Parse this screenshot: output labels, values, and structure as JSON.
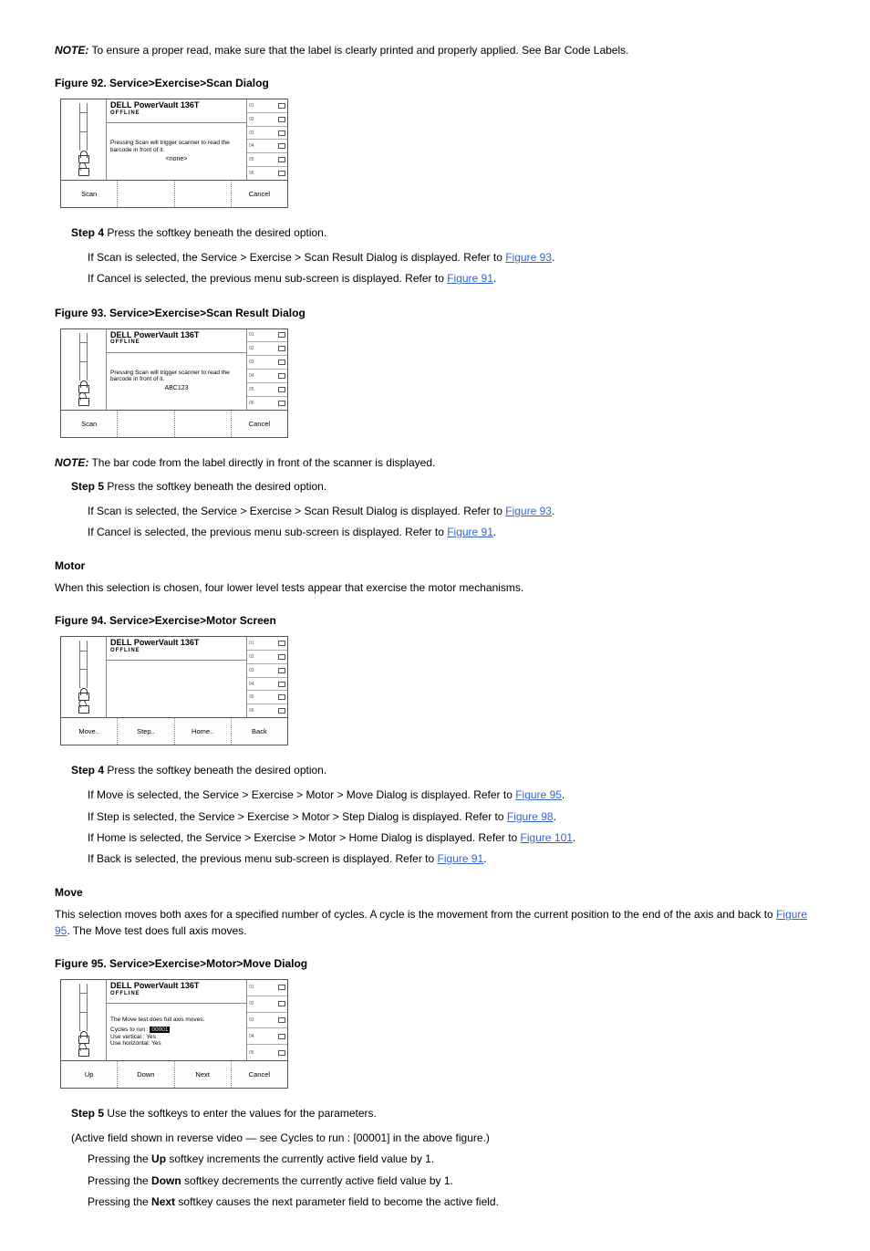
{
  "note1": {
    "label": "NOTE:",
    "text": " To ensure a proper read, make sure that the label is clearly printed and properly applied. See Bar Code Labels."
  },
  "fig92": {
    "label": "Figure 92. Service>Exercise>Scan Dialog",
    "logo": "DELL PowerVault 136T",
    "offline": "OFFLINE",
    "message": "Pressing Scan will trigger scanner to read the barcode in front of it.",
    "value": "<none>",
    "buttons": [
      "Scan",
      "",
      "",
      "Cancel"
    ]
  },
  "step4": {
    "num": "Step 4",
    "text": "   Press the softkey beneath the desired option."
  },
  "step4_items": [
    "If Scan is selected, the Service > Exercise > Scan Result Dialog is displayed. Refer to ",
    "If Cancel is selected, the previous menu sub-screen is displayed. Refer to "
  ],
  "step4_links": {
    "fig93": "Figure 93",
    "fig91": "Figure 91"
  },
  "fig93": {
    "label": "Figure 93. Service>Exercise>Scan Result Dialog",
    "logo": "DELL PowerVault 136T",
    "offline": "OFFLINE",
    "message": "Pressing Scan will trigger scanner to read the barcode in front of it.",
    "value": "ABC123",
    "buttons": [
      "Scan",
      "",
      "",
      "Cancel"
    ]
  },
  "note2": {
    "label": "NOTE:",
    "text": " The bar code from the label directly in front of the scanner is displayed."
  },
  "step5": {
    "num": "Step 5",
    "text": "   Press the softkey beneath the desired option."
  },
  "step5_items": [
    "If Scan is selected, the Service > Exercise > Scan Result Dialog is displayed. Refer to ",
    "If Cancel is selected, the previous menu sub-screen is displayed. Refer to "
  ],
  "step5_links": {
    "fig93": "Figure 93",
    "fig91": "Figure 91"
  },
  "motor_title": "Motor",
  "motor_text": "When this selection is chosen, four lower level tests appear that exercise the motor mechanisms.",
  "fig94": {
    "label": "Figure 94. Service>Exercise>Motor Screen",
    "logo": "DELL PowerVault 136T",
    "offline": "OFFLINE",
    "buttons": [
      "Move..",
      "Step..",
      "Home..",
      "Back"
    ]
  },
  "step4b": {
    "num": "Step 4",
    "text": "   Press the softkey beneath the desired option."
  },
  "step4b_items": [
    {
      "pre": "If Move is selected, the Service > Exercise > Motor > Move Dialog is displayed. Refer to ",
      "link": "Figure 95"
    },
    {
      "pre": "If Step is selected, the Service > Exercise > Motor > Step Dialog is displayed. Refer to ",
      "link": "Figure 98"
    },
    {
      "pre": "If Home is selected, the Service > Exercise > Motor > Home Dialog is displayed. Refer to ",
      "link": "Figure 101"
    },
    {
      "pre": "If Back is selected, the previous menu sub-screen is displayed. Refer to ",
      "link": "Figure 91"
    }
  ],
  "move_title": "Move",
  "move_text_pre": "This selection moves both axes for a specified number of cycles. A cycle is the movement from the current position to the end of the axis and back to ",
  "move_text_link": "Figure 95",
  "move_text_post": ". The Move test does full axis moves.",
  "fig95": {
    "label": "Figure 95. Service>Exercise>Motor>Move Dialog",
    "logo": "DELL PowerVault 136T",
    "offline": "OFFLINE",
    "message_top": "The Move test does full axis moves.",
    "line1": "Cycles to run :",
    "val1": "00001",
    "line2": "Use vertical  :",
    "val2": "Yes",
    "line3": "Use horizontal:",
    "val3": "Yes",
    "buttons": [
      "Up",
      "Down",
      "Next",
      "Cancel"
    ]
  },
  "step5b": {
    "num": "Step 5",
    "text": "   Use the softkeys to enter the values for the parameters."
  },
  "step5b_paren": "(Active field shown in reverse video — see Cycles to run : [00001] in the above figure.)",
  "step5b_items": [
    {
      "pre": "Pressing the ",
      "bold": "Up",
      "post": " softkey increments the currently active field value by 1."
    },
    {
      "pre": "Pressing the ",
      "bold": "Down",
      "post": " softkey decrements the currently active field value by 1."
    },
    {
      "pre": "Pressing the ",
      "bold": "Next",
      "post": " softkey causes the next parameter field to become the active field."
    }
  ],
  "right_tags6": [
    "01",
    "02",
    "03",
    "04",
    "05",
    "06"
  ],
  "right_tags5": [
    "01",
    "02",
    "03",
    "04",
    "05"
  ]
}
